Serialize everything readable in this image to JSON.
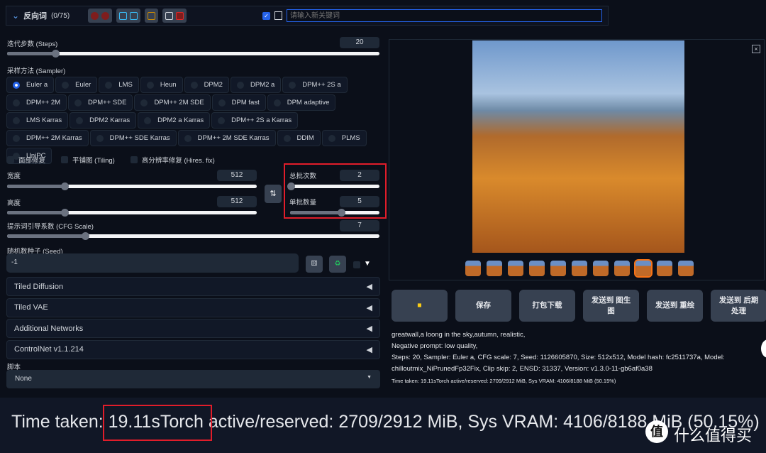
{
  "negative": {
    "title": "反向词",
    "count": "(0/75)",
    "keyword_placeholder": "请输入新关键词"
  },
  "steps": {
    "label": "迭代步数 (Steps)",
    "value": "20",
    "fraction": 0.13
  },
  "sampler": {
    "label": "采样方法 (Sampler)",
    "selected": "Euler a",
    "options": [
      "Euler a",
      "Euler",
      "LMS",
      "Heun",
      "DPM2",
      "DPM2 a",
      "DPM++ 2S a",
      "DPM++ 2M",
      "DPM++ SDE",
      "DPM++ 2M SDE",
      "DPM fast",
      "DPM adaptive",
      "LMS Karras",
      "DPM2 Karras",
      "DPM2 a Karras",
      "DPM++ 2S a Karras",
      "DPM++ 2M Karras",
      "DPM++ SDE Karras",
      "DPM++ 2M SDE Karras",
      "DDIM",
      "PLMS",
      "UniPC"
    ]
  },
  "checks": [
    "面部修复",
    "平铺图 (Tiling)",
    "高分辨率修复 (Hires. fix)"
  ],
  "width": {
    "label": "宽度",
    "value": "512",
    "fraction": 0.23
  },
  "height": {
    "label": "高度",
    "value": "512",
    "fraction": 0.23
  },
  "batch_count": {
    "label": "总批次数",
    "value": "2",
    "fraction": 0.01
  },
  "batch_size": {
    "label": "单批数量",
    "value": "5",
    "fraction": 0.57
  },
  "cfg": {
    "label": "提示词引导系数 (CFG Scale)",
    "value": "7",
    "fraction": 0.21
  },
  "seed": {
    "label": "随机数种子 (Seed)",
    "value": "-1"
  },
  "accordions": [
    "Tiled Diffusion",
    "Tiled VAE",
    "Additional Networks",
    "ControlNet v1.1.214"
  ],
  "script": {
    "label": "脚本",
    "value": "None"
  },
  "buttons": [
    "保存",
    "打包下载",
    "发送到 图生图",
    "发送到 重绘",
    "发送到 后期处理"
  ],
  "info": {
    "prompt": "greatwall,a loong in the sky,autumn, realistic,",
    "negative": "Negative prompt: low quality,",
    "params1": "Steps: 20, Sampler: Euler a, CFG scale: 7, Seed: 1126605870, Size: 512x512, Model hash: fc2511737a, Model:",
    "params2": "chilloutmix_NiPrunedFp32Fix, Clip skip: 2, ENSD: 31337, Version: v1.3.0-11-gb6af0a38",
    "time": "Time taken: 19.11sTorch active/reserved: 2709/2912 MiB, Sys VRAM: 4106/8188 MiB (50.15%)"
  },
  "bottom": {
    "text": "Time taken: 19.11sTorch active/reserved: 2709/2912 MiB, Sys VRAM: 4106/8188 MiB (50.15%)",
    "watermark": "什么值得买",
    "logo": "值"
  },
  "colors": {
    "accent": "#2563eb",
    "highlight": "#e11d2a",
    "folder": "#facc15",
    "selected_thumb": "#f97316"
  }
}
